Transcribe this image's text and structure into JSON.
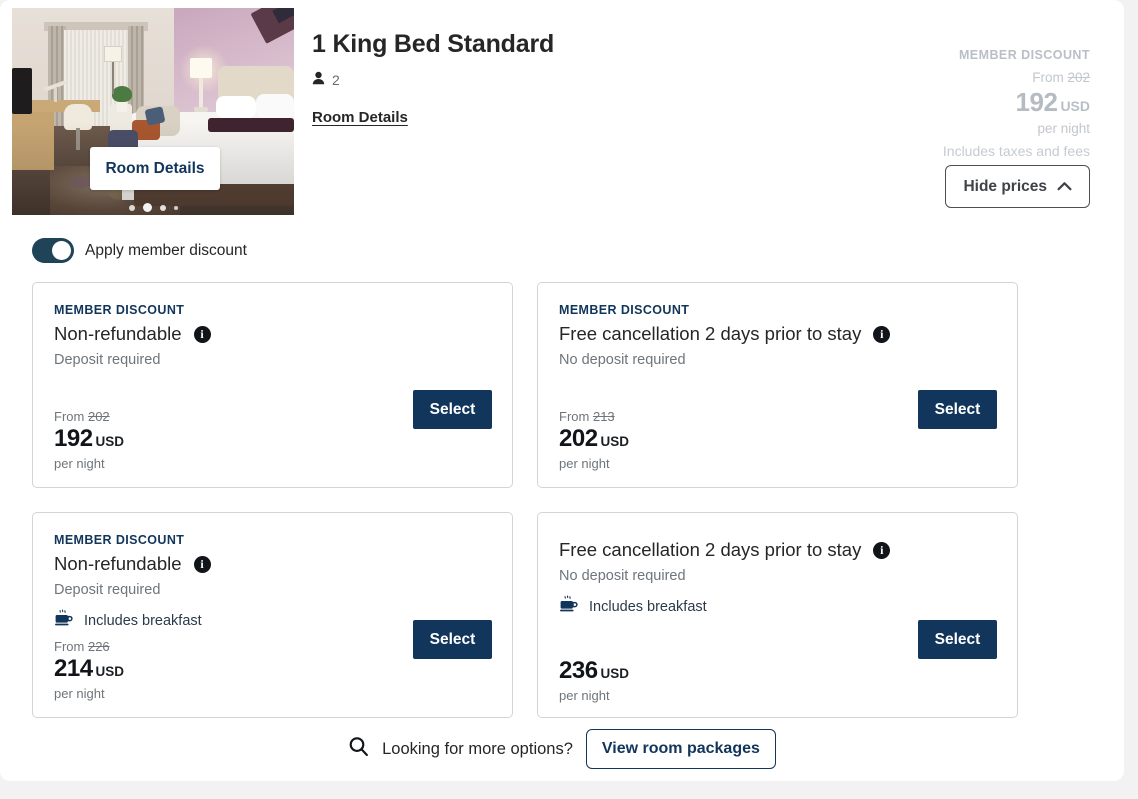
{
  "room": {
    "title": "1 King Bed Standard",
    "occupancy": "2",
    "occupancy_icon": "person-icon",
    "details_link": "Room Details",
    "photo_overlay_button": "Room Details",
    "carousel_dot_count": 4,
    "carousel_active_index": 1
  },
  "price_summary": {
    "member_label": "MEMBER DISCOUNT",
    "from_prefix": "From",
    "from_struck": "202",
    "amount": "192",
    "currency": "USD",
    "per_night": "per night",
    "taxes_note": "Includes taxes and fees",
    "hide_prices_label": "Hide prices",
    "hide_prices_icon": "chevron-up-icon",
    "state": "faded"
  },
  "member_toggle": {
    "label": "Apply member discount",
    "state_on": true
  },
  "rates": [
    {
      "member_label": "MEMBER DISCOUNT",
      "title": "Non-refundable",
      "info_icon": "info-icon",
      "deposit": "Deposit required",
      "perk": null,
      "from_prefix": "From",
      "from_struck": "202",
      "amount": "192",
      "currency": "USD",
      "per_night": "per night",
      "select_label": "Select"
    },
    {
      "member_label": "MEMBER DISCOUNT",
      "title": "Free cancellation 2 days prior to stay",
      "info_icon": "info-icon",
      "deposit": "No deposit required",
      "perk": null,
      "from_prefix": "From",
      "from_struck": "213",
      "amount": "202",
      "currency": "USD",
      "per_night": "per night",
      "select_label": "Select"
    },
    {
      "member_label": "MEMBER DISCOUNT",
      "title": "Non-refundable",
      "info_icon": "info-icon",
      "deposit": "Deposit required",
      "perk": "Includes breakfast",
      "perk_icon": "coffee-cup-icon",
      "from_prefix": "From",
      "from_struck": "226",
      "amount": "214",
      "currency": "USD",
      "per_night": "per night",
      "select_label": "Select"
    },
    {
      "member_label": null,
      "title": "Free cancellation 2 days prior to stay",
      "info_icon": "info-icon",
      "deposit": "No deposit required",
      "perk": "Includes breakfast",
      "perk_icon": "coffee-cup-icon",
      "from_prefix": null,
      "from_struck": null,
      "amount": "236",
      "currency": "USD",
      "per_night": "per night",
      "select_label": "Select"
    }
  ],
  "footer": {
    "search_icon": "search-icon",
    "prompt": "Looking for more options?",
    "packages_button": "View room packages"
  },
  "colors": {
    "brand_navy": "#12355b",
    "toggle_on": "#1f4357",
    "page_background": "#f2f2f2",
    "card_background": "#ffffff",
    "card_border": "#d2d5d8",
    "muted_text": "#6e757b",
    "faded_price": "#b5bbc2"
  }
}
